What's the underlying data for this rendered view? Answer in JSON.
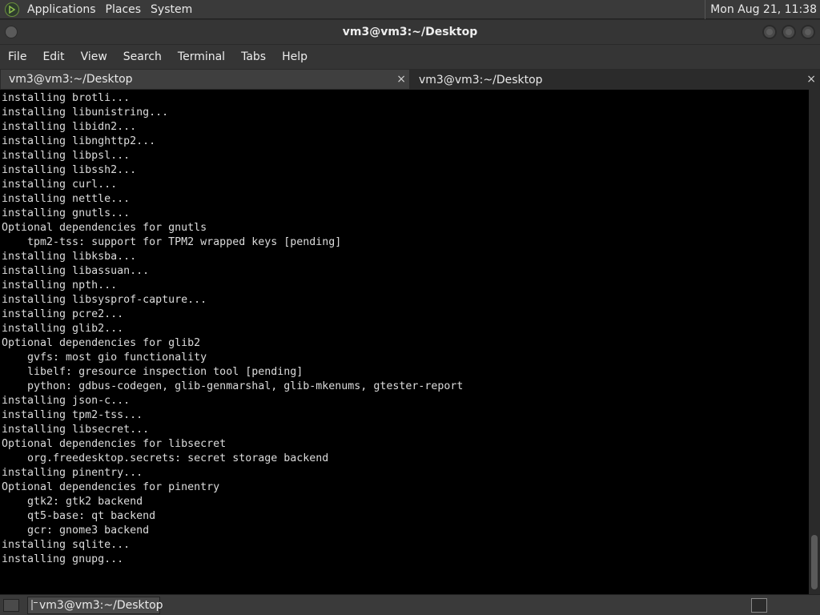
{
  "top_panel": {
    "logo_icon": "distro-logo-icon",
    "menus": [
      "Applications",
      "Places",
      "System"
    ],
    "clock": "Mon Aug 21, 11:38"
  },
  "window": {
    "title": "vm3@vm3:~/Desktop"
  },
  "menubar": {
    "items": [
      "File",
      "Edit",
      "View",
      "Search",
      "Terminal",
      "Tabs",
      "Help"
    ]
  },
  "tabs": [
    {
      "label": "vm3@vm3:~/Desktop",
      "close": "×"
    },
    {
      "label": "vm3@vm3:~/Desktop",
      "close": "×"
    }
  ],
  "terminal": {
    "lines": [
      "installing brotli...",
      "installing libunistring...",
      "installing libidn2...",
      "installing libnghttp2...",
      "installing libpsl...",
      "installing libssh2...",
      "installing curl...",
      "installing nettle...",
      "installing gnutls...",
      "Optional dependencies for gnutls",
      "    tpm2-tss: support for TPM2 wrapped keys [pending]",
      "installing libksba...",
      "installing libassuan...",
      "installing npth...",
      "installing libsysprof-capture...",
      "installing pcre2...",
      "installing glib2...",
      "Optional dependencies for glib2",
      "    gvfs: most gio functionality",
      "    libelf: gresource inspection tool [pending]",
      "    python: gdbus-codegen, glib-genmarshal, glib-mkenums, gtester-report",
      "installing json-c...",
      "installing tpm2-tss...",
      "installing libsecret...",
      "Optional dependencies for libsecret",
      "    org.freedesktop.secrets: secret storage backend",
      "installing pinentry...",
      "Optional dependencies for pinentry",
      "    gtk2: gtk2 backend",
      "    qt5-base: qt backend",
      "    gcr: gnome3 backend",
      "installing sqlite...",
      "installing gnupg..."
    ]
  },
  "taskbar": {
    "task_label": "vm3@vm3:~/Desktop"
  }
}
